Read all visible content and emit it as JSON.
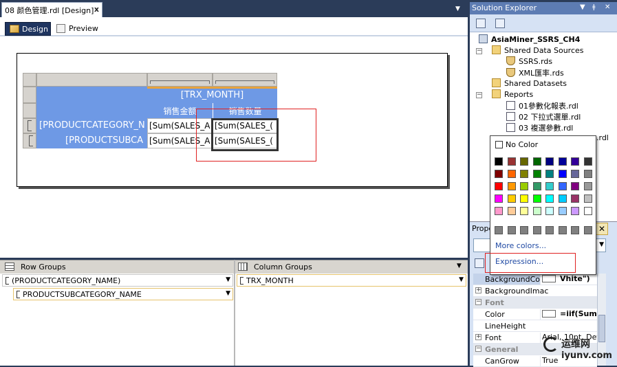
{
  "document_tab": {
    "title": "08 颜色管理.rdl [Design]",
    "close": "x"
  },
  "designer_tabs": {
    "design": "Design",
    "preview": "Preview"
  },
  "tablix": {
    "header_month": "[TRX_MONTH]",
    "header_sales_amount": "销售金额",
    "header_sales_qty": "销售数量",
    "row1_group": "[PRODUCTCATEGORY_N",
    "row1_amount": "[Sum(SALES_A",
    "row1_qty": "[Sum(SALES_(",
    "row2_group": "[PRODUCTSUBCA",
    "row2_amount": "[Sum(SALES_A",
    "row2_qty": "[Sum(SALES_("
  },
  "groups": {
    "row_groups_label": "Row Groups",
    "column_groups_label": "Column Groups",
    "row_group_1": "(PRODUCTCATEGORY_NAME)",
    "row_group_2": "PRODUCTSUBCATEGORY_NAME",
    "column_group_1": "TRX_MONTH"
  },
  "solution_explorer": {
    "title": "Solution Explorer",
    "project": "AsiaMiner_SSRS_CH4",
    "shared_data_sources": "Shared Data Sources",
    "ds_1": "SSRS.rds",
    "ds_2": "XML匯率.rds",
    "shared_datasets": "Shared Datasets",
    "reports": "Reports",
    "report_1": "01參數化報表.rdl",
    "report_2": "02 下拉式選單.rdl",
    "report_3": "03 複選參數.rdl",
    "report_4": ".rdl"
  },
  "properties": {
    "title": "Prope",
    "close": "✕",
    "rows": {
      "background_color": {
        "name": "BackgroundColo",
        "value": "Vhite\")"
      },
      "background_image": {
        "name": "BackgroundImac",
        "value": ""
      },
      "font_category": "Font",
      "color": {
        "name": "Color",
        "value": "=iif(Sum("
      },
      "line_height": {
        "name": "LineHeight",
        "value": ""
      },
      "font": {
        "name": "Font",
        "value": "Arial, 10pt, Defa"
      },
      "general_category": "General",
      "can_grow": {
        "name": "CanGrow",
        "value": "True"
      }
    }
  },
  "color_picker": {
    "no_color": "No Color",
    "more_colors": "More colors...",
    "expression": "Expression...",
    "swatches": [
      [
        "#000000",
        "#993333",
        "#666600",
        "#006600",
        "#000080",
        "#000099",
        "#330099",
        "#333333"
      ],
      [
        "#800000",
        "#ff6600",
        "#808000",
        "#008000",
        "#008080",
        "#0000ff",
        "#666699",
        "#808080"
      ],
      [
        "#ff0000",
        "#ff9900",
        "#99cc00",
        "#339966",
        "#33cccc",
        "#3366ff",
        "#800080",
        "#999999"
      ],
      [
        "#ff00ff",
        "#ffcc00",
        "#ffff00",
        "#00ff00",
        "#00ffff",
        "#00ccff",
        "#993366",
        "#c0c0c0"
      ],
      [
        "#ff99cc",
        "#ffcc99",
        "#ffff99",
        "#ccffcc",
        "#ccffff",
        "#99ccff",
        "#cc99ff",
        "#ffffff"
      ],
      [
        "#808080",
        "#808080",
        "#808080",
        "#808080",
        "#808080",
        "#808080",
        "#808080",
        "#808080"
      ]
    ]
  },
  "watermark": {
    "cn": "运维网",
    "url": "iyunv.com"
  }
}
